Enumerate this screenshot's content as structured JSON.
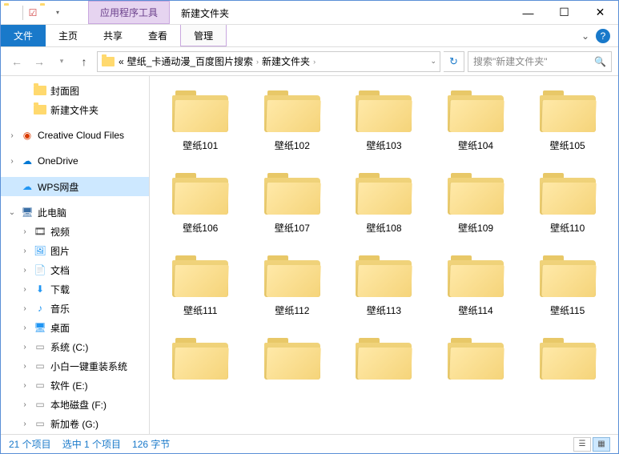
{
  "titlebar": {
    "contextual_tab": "应用程序工具",
    "window_title": "新建文件夹"
  },
  "ribbon": {
    "file": "文件",
    "home": "主页",
    "share": "共享",
    "view": "查看",
    "manage": "管理"
  },
  "address": {
    "prefix": "«",
    "crumb1": "壁纸_卡通动漫_百度图片搜索",
    "crumb2": "新建文件夹"
  },
  "search": {
    "placeholder": "搜索\"新建文件夹\""
  },
  "tree": {
    "quick": [
      {
        "label": "封面图"
      },
      {
        "label": "新建文件夹"
      }
    ],
    "cc": "Creative Cloud Files",
    "onedrive": "OneDrive",
    "wps": "WPS网盘",
    "thispc": "此电脑",
    "pc_children": [
      {
        "label": "视频",
        "icon": "video"
      },
      {
        "label": "图片",
        "icon": "pic"
      },
      {
        "label": "文档",
        "icon": "doc"
      },
      {
        "label": "下载",
        "icon": "down"
      },
      {
        "label": "音乐",
        "icon": "music"
      },
      {
        "label": "桌面",
        "icon": "desk"
      },
      {
        "label": "系统 (C:)",
        "icon": "drive"
      },
      {
        "label": "小白一键重装系统",
        "icon": "drive"
      },
      {
        "label": "软件 (E:)",
        "icon": "drive"
      },
      {
        "label": "本地磁盘 (F:)",
        "icon": "drive"
      },
      {
        "label": "新加卷 (G:)",
        "icon": "drive"
      }
    ]
  },
  "files": [
    {
      "name": "壁纸101"
    },
    {
      "name": "壁纸102"
    },
    {
      "name": "壁纸103"
    },
    {
      "name": "壁纸104"
    },
    {
      "name": "壁纸105"
    },
    {
      "name": "壁纸106"
    },
    {
      "name": "壁纸107"
    },
    {
      "name": "壁纸108"
    },
    {
      "name": "壁纸109"
    },
    {
      "name": "壁纸110"
    },
    {
      "name": "壁纸111"
    },
    {
      "name": "壁纸112"
    },
    {
      "name": "壁纸113"
    },
    {
      "name": "壁纸114"
    },
    {
      "name": "壁纸115"
    },
    {
      "name": ""
    },
    {
      "name": ""
    },
    {
      "name": ""
    },
    {
      "name": ""
    },
    {
      "name": ""
    }
  ],
  "status": {
    "items": "21 个项目",
    "selected": "选中 1 个项目",
    "size": "126 字节"
  }
}
